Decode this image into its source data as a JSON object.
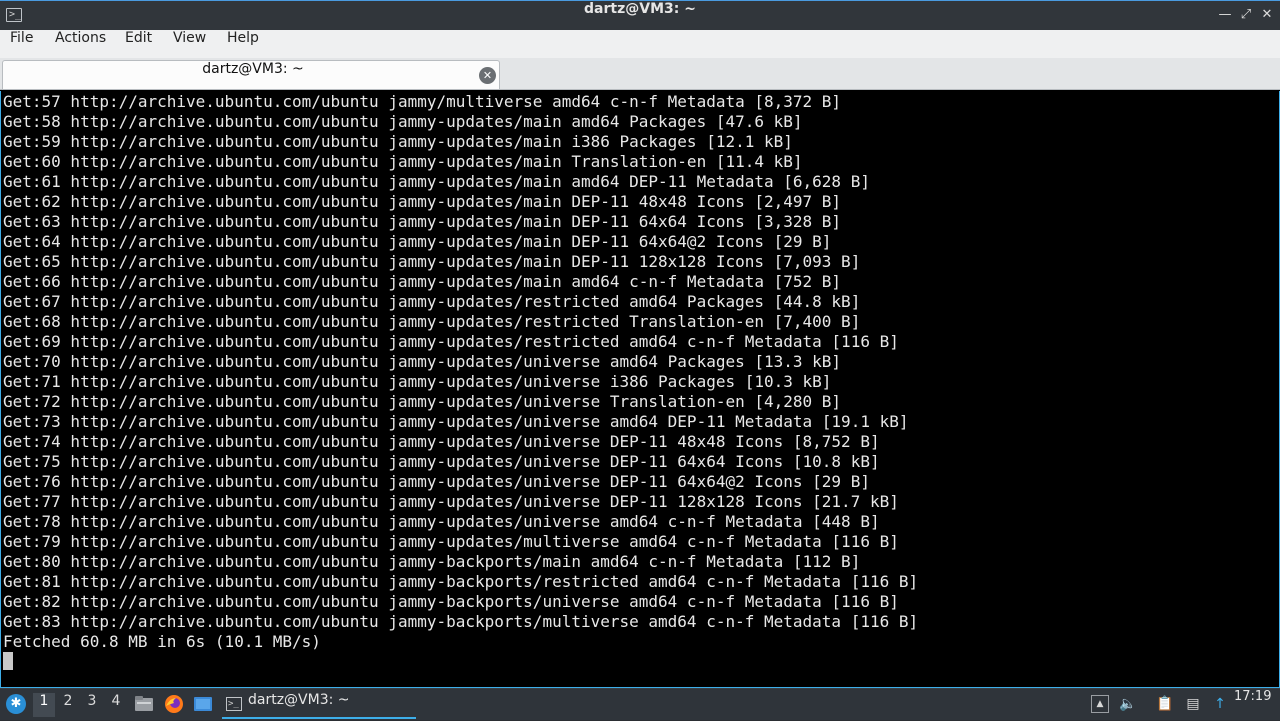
{
  "window": {
    "title": "dartz@VM3: ~"
  },
  "menubar": {
    "items": [
      "File",
      "Actions",
      "Edit",
      "View",
      "Help"
    ]
  },
  "tabs": [
    {
      "label": "dartz@VM3: ~"
    }
  ],
  "terminal": {
    "lines": [
      "Get:57 http://archive.ubuntu.com/ubuntu jammy/multiverse amd64 c-n-f Metadata [8,372 B]",
      "Get:58 http://archive.ubuntu.com/ubuntu jammy-updates/main amd64 Packages [47.6 kB]",
      "Get:59 http://archive.ubuntu.com/ubuntu jammy-updates/main i386 Packages [12.1 kB]",
      "Get:60 http://archive.ubuntu.com/ubuntu jammy-updates/main Translation-en [11.4 kB]",
      "Get:61 http://archive.ubuntu.com/ubuntu jammy-updates/main amd64 DEP-11 Metadata [6,628 B]",
      "Get:62 http://archive.ubuntu.com/ubuntu jammy-updates/main DEP-11 48x48 Icons [2,497 B]",
      "Get:63 http://archive.ubuntu.com/ubuntu jammy-updates/main DEP-11 64x64 Icons [3,328 B]",
      "Get:64 http://archive.ubuntu.com/ubuntu jammy-updates/main DEP-11 64x64@2 Icons [29 B]",
      "Get:65 http://archive.ubuntu.com/ubuntu jammy-updates/main DEP-11 128x128 Icons [7,093 B]",
      "Get:66 http://archive.ubuntu.com/ubuntu jammy-updates/main amd64 c-n-f Metadata [752 B]",
      "Get:67 http://archive.ubuntu.com/ubuntu jammy-updates/restricted amd64 Packages [44.8 kB]",
      "Get:68 http://archive.ubuntu.com/ubuntu jammy-updates/restricted Translation-en [7,400 B]",
      "Get:69 http://archive.ubuntu.com/ubuntu jammy-updates/restricted amd64 c-n-f Metadata [116 B]",
      "Get:70 http://archive.ubuntu.com/ubuntu jammy-updates/universe amd64 Packages [13.3 kB]",
      "Get:71 http://archive.ubuntu.com/ubuntu jammy-updates/universe i386 Packages [10.3 kB]",
      "Get:72 http://archive.ubuntu.com/ubuntu jammy-updates/universe Translation-en [4,280 B]",
      "Get:73 http://archive.ubuntu.com/ubuntu jammy-updates/universe amd64 DEP-11 Metadata [19.1 kB]",
      "Get:74 http://archive.ubuntu.com/ubuntu jammy-updates/universe DEP-11 48x48 Icons [8,752 B]",
      "Get:75 http://archive.ubuntu.com/ubuntu jammy-updates/universe DEP-11 64x64 Icons [10.8 kB]",
      "Get:76 http://archive.ubuntu.com/ubuntu jammy-updates/universe DEP-11 64x64@2 Icons [29 B]",
      "Get:77 http://archive.ubuntu.com/ubuntu jammy-updates/universe DEP-11 128x128 Icons [21.7 kB]",
      "Get:78 http://archive.ubuntu.com/ubuntu jammy-updates/universe amd64 c-n-f Metadata [448 B]",
      "Get:79 http://archive.ubuntu.com/ubuntu jammy-updates/multiverse amd64 c-n-f Metadata [116 B]",
      "Get:80 http://archive.ubuntu.com/ubuntu jammy-backports/main amd64 c-n-f Metadata [112 B]",
      "Get:81 http://archive.ubuntu.com/ubuntu jammy-backports/restricted amd64 c-n-f Metadata [116 B]",
      "Get:82 http://archive.ubuntu.com/ubuntu jammy-backports/universe amd64 c-n-f Metadata [116 B]",
      "Get:83 http://archive.ubuntu.com/ubuntu jammy-backports/multiverse amd64 c-n-f Metadata [116 B]",
      "Fetched 60.8 MB in 6s (10.1 MB/s)"
    ]
  },
  "taskbar": {
    "workspaces": [
      "1",
      "2",
      "3",
      "4"
    ],
    "active_workspace": "1",
    "quicklaunch": [
      "file-manager-icon",
      "firefox-icon",
      "desktop-icon"
    ],
    "tasks": [
      {
        "label": "dartz@VM3: ~",
        "icon": "terminal-icon"
      }
    ],
    "tray": [
      "tray-expand-icon",
      "volume-icon",
      "clipboard-icon",
      "network-icon",
      "update-notifier-icon"
    ],
    "clock": "17:19"
  },
  "colors": {
    "accent": "#3daee9",
    "terminal_bg": "#000000",
    "terminal_fg": "#e8e8e8",
    "panel_bg": "#2f343a"
  }
}
